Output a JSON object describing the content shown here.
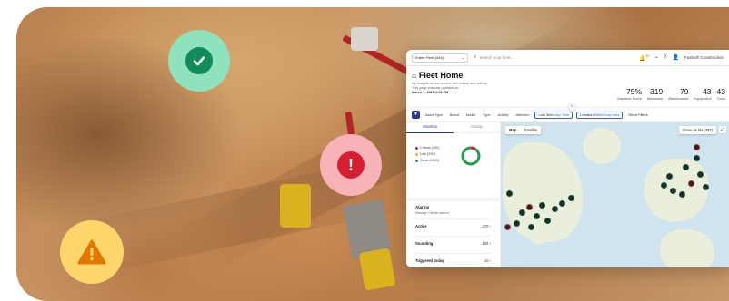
{
  "hero": {
    "badges": [
      {
        "name": "ok",
        "icon": "checkmark-icon",
        "color": "#128a5a"
      },
      {
        "name": "error",
        "icon": "exclamation-icon",
        "color": "#d61f31"
      },
      {
        "name": "warning",
        "icon": "warning-triangle-icon",
        "color": "#e07800"
      }
    ]
  },
  "topbar": {
    "fleet_select": "Entire Fleet (344)",
    "search_placeholder": "Search your fleet...",
    "notif_count": "9+",
    "user": "Foxburh Construction"
  },
  "header": {
    "title": "Fleet Home",
    "subtitle_line1": "My insights on the current fleet status and activity.",
    "subtitle_line2": "This page was last updated on",
    "updated": "March 7, 2022 1:03 PM"
  },
  "stats": [
    {
      "value": "75%",
      "label": "Machine Score"
    },
    {
      "value": "319",
      "label": "Machines"
    },
    {
      "value": "79",
      "label": "Attachments"
    },
    {
      "value": "43",
      "label": "Equipment"
    },
    {
      "value": "43",
      "label": "Tools"
    }
  ],
  "filters": {
    "asset_type": "Asset Type",
    "brand": "Brand",
    "model": "Model",
    "type": "Type",
    "activity": "Activity",
    "attention": "Attention",
    "last_seen": "Last Seen",
    "last_seen_value": "Any Time",
    "location": "Location",
    "location_value": "Within map area",
    "reset": "Reset Filters"
  },
  "tabs": {
    "attention": "Attention",
    "activity": "Activity"
  },
  "legend": [
    {
      "label": "Critical (400)",
      "color": "#d61f31"
    },
    {
      "label": "Low (290)",
      "color": "#f0b400"
    },
    {
      "label": "Good (4000)",
      "color": "#1e9e4a"
    }
  ],
  "alarms": {
    "heading": "Alarms",
    "manage": "Manage Obedic alarms",
    "rows": [
      {
        "label": "Active",
        "count": "270"
      },
      {
        "label": "Sounding",
        "count": "136"
      },
      {
        "label": "Triggered today",
        "count": "10"
      }
    ]
  },
  "map": {
    "tab_map": "Map",
    "tab_satellite": "Satellite",
    "show_list": "Show as list (497)"
  }
}
